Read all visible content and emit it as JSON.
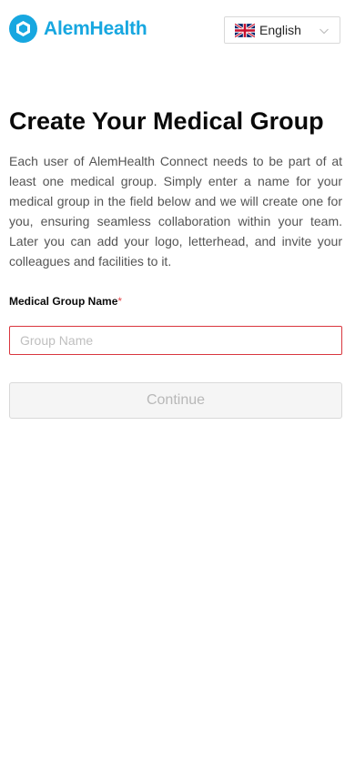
{
  "header": {
    "logo_text": "AlemHealth",
    "brand_color": "#17a7e0",
    "language": {
      "selected": "English",
      "flag_icon": "uk-flag-icon",
      "chevron_icon": "chevron-down-icon"
    }
  },
  "main": {
    "title": "Create Your Medical Group",
    "description": "Each user of AlemHealth Connect needs to be part of at least one medical group. Simply enter a name for your medical group in the field below and we will create one for you, ensuring seamless collaboration within your team. Later you can add your logo, letterhead, and invite your colleagues and facilities to it.",
    "form": {
      "label": "Medical Group Name",
      "required_mark": "*",
      "input_value": "",
      "input_placeholder": "Group Name",
      "submit_label": "Continue",
      "submit_disabled": true
    }
  }
}
